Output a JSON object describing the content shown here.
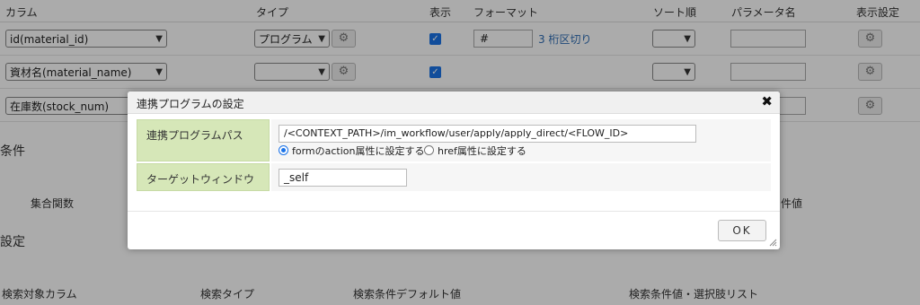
{
  "table": {
    "headers": {
      "column": "カラム",
      "type": "タイプ",
      "display": "表示",
      "format": "フォーマット",
      "sort_order": "ソート順",
      "param_name": "パラメータ名",
      "display_settings": "表示設定"
    },
    "rows": [
      {
        "column": "id(material_id)",
        "type": "プログラム",
        "display_checked": true,
        "format_value": "#",
        "format_link": "3 桁区切り"
      },
      {
        "column": "資材名(material_name)",
        "type": "",
        "display_checked": true
      },
      {
        "column": "在庫数(stock_num)"
      }
    ]
  },
  "sections": {
    "conditions_partial": "条件",
    "aggregate_header": "集合関数",
    "condition_value_partial": "件値",
    "settings_partial": "設定",
    "search_headers": {
      "target_column": "検索対象カラム",
      "search_type": "検索タイプ",
      "default_value": "検索条件デフォルト値",
      "value_list": "検索条件値・選択肢リスト"
    }
  },
  "dialog": {
    "title": "連携プログラムの設定",
    "path_label": "連携プログラムパス",
    "path_value": "/<CONTEXT_PATH>/im_workflow/user/apply/apply_direct/<FLOW_ID>",
    "radio_form_label": "formのaction属性に設定する",
    "radio_href_label": "href属性に設定する",
    "radio_selected": "form",
    "window_label": "ターゲットウィンドウ",
    "window_value": "_self",
    "ok_label": "OK",
    "close_glyph": "✖"
  }
}
